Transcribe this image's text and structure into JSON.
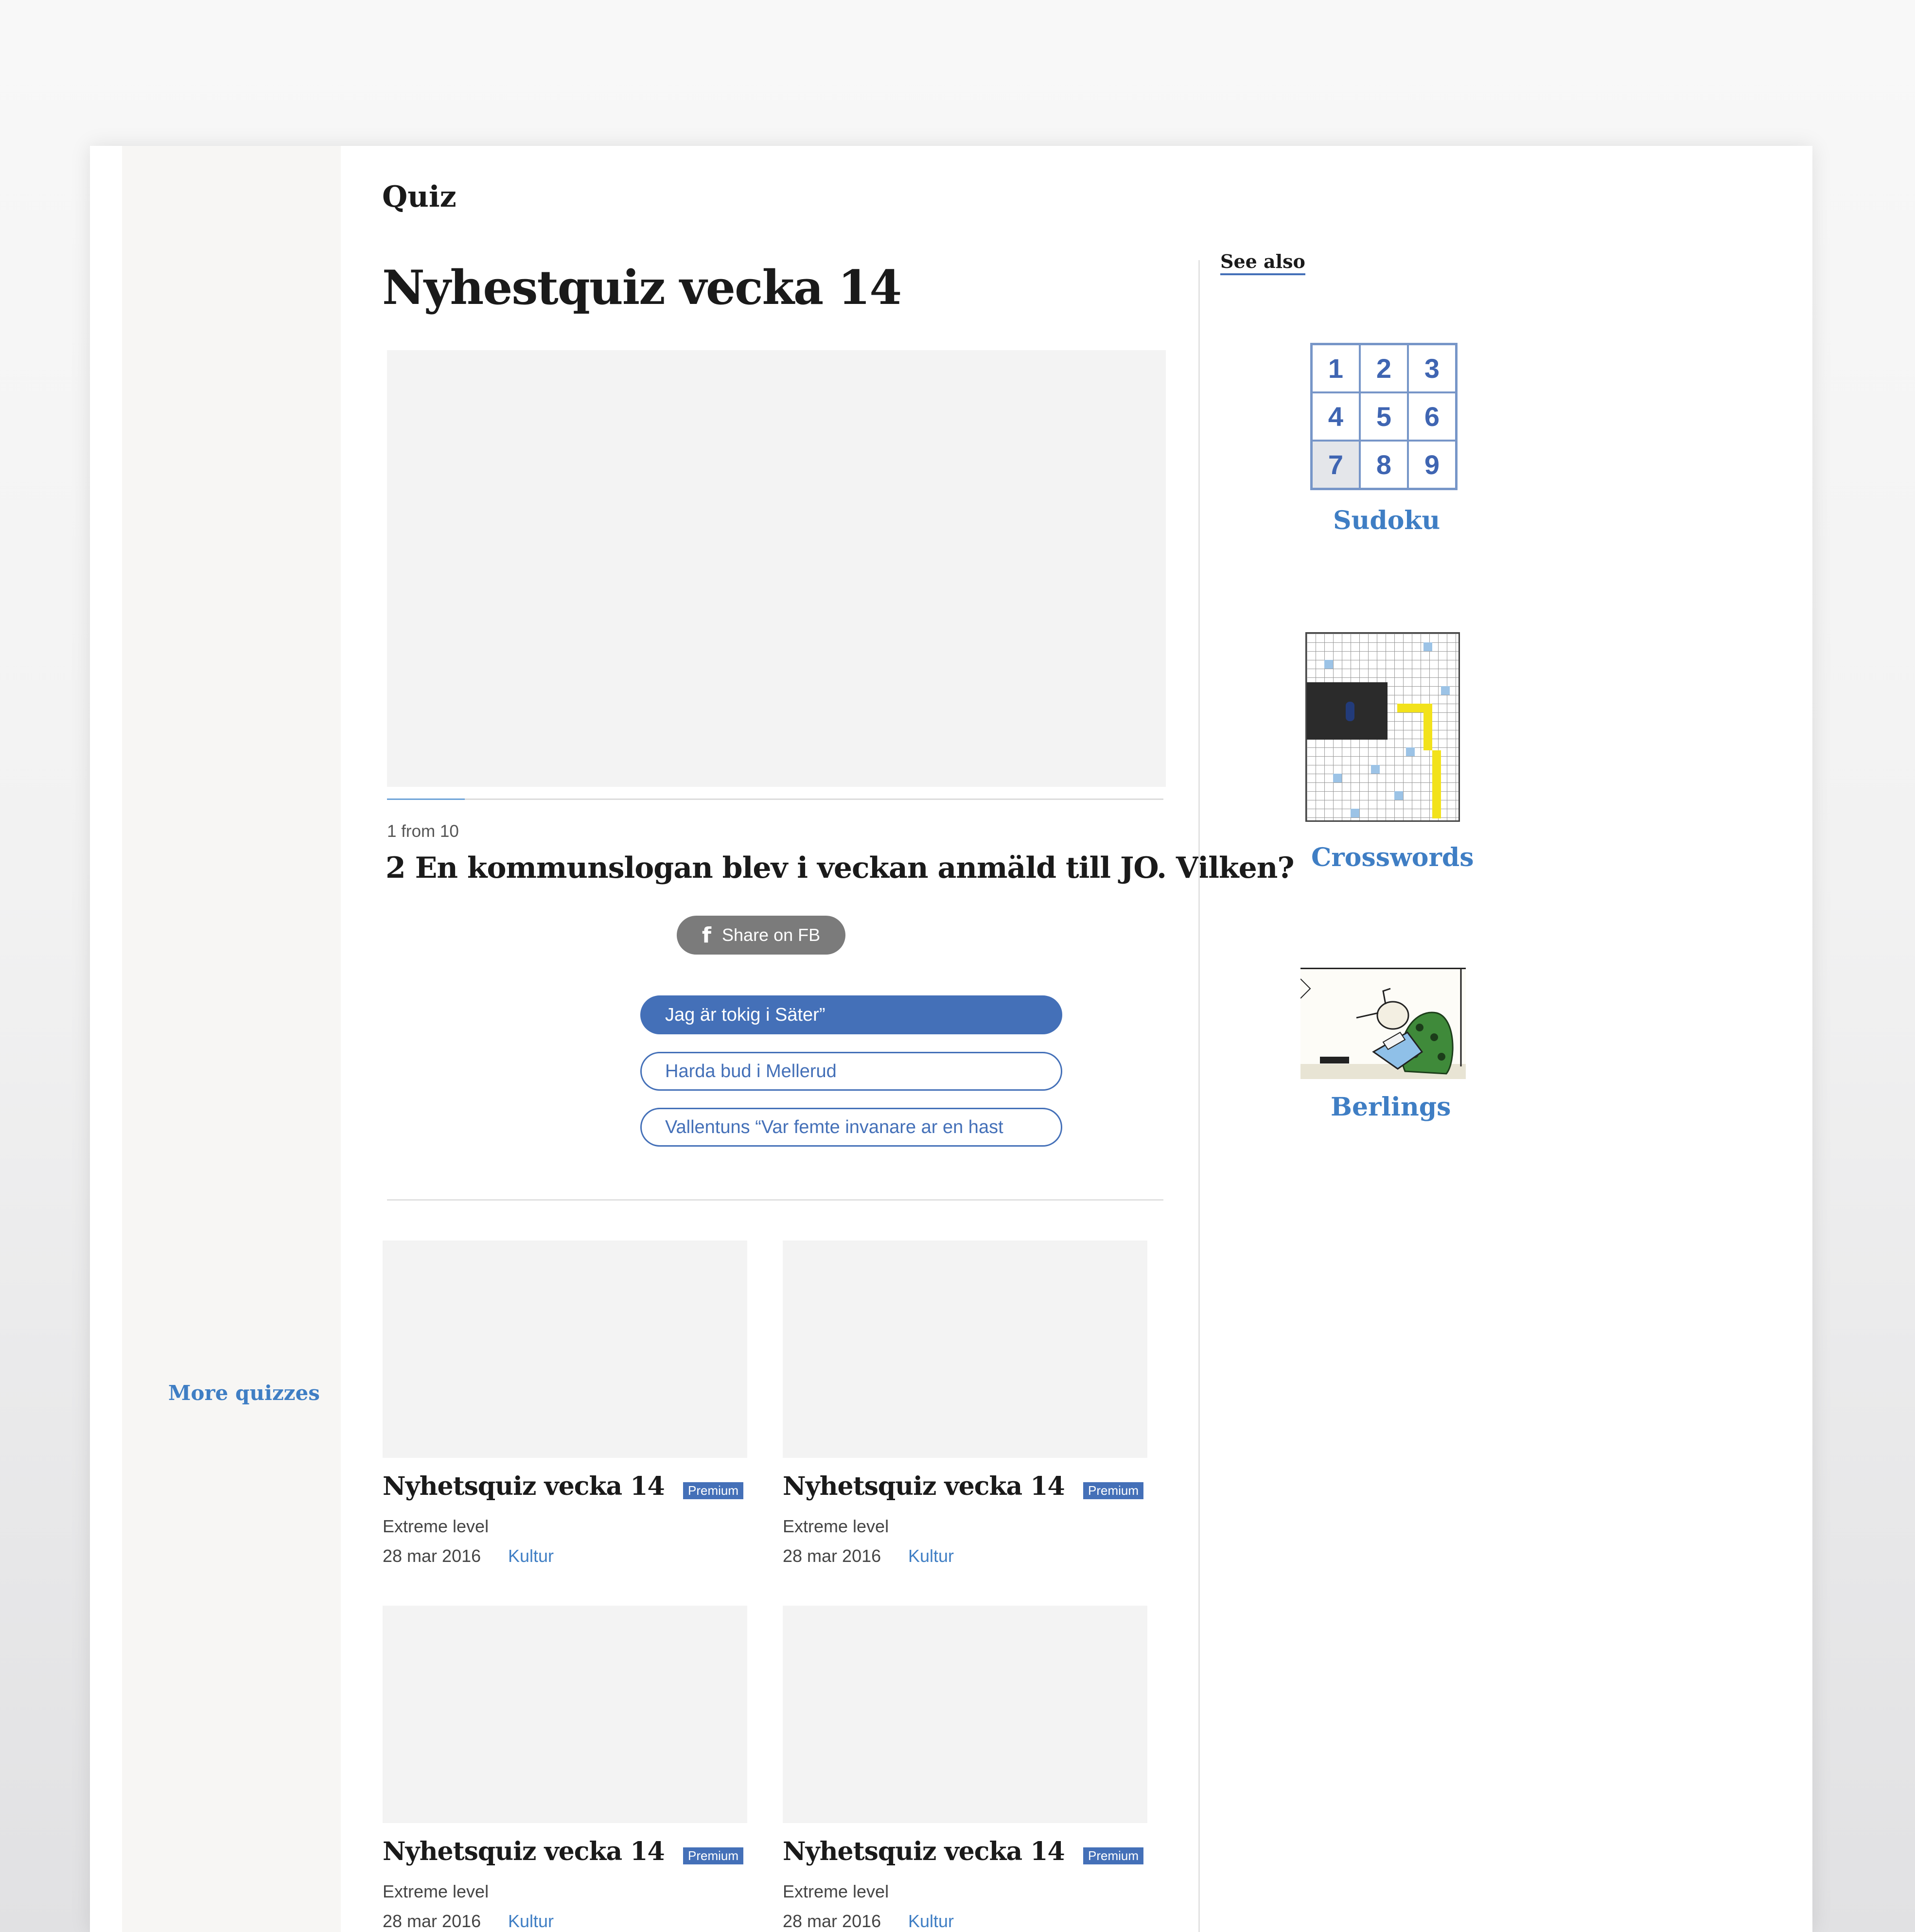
{
  "section": {
    "title": "Quiz"
  },
  "quiz": {
    "title": "Nyhestquiz vecka 14",
    "progress_text": "1 from 10",
    "progress_fraction": 0.1,
    "question": "2 En kommunslogan blev i veckan anmäld till JO. Vilken?",
    "share_label": "Share on FB",
    "answers": [
      {
        "label": "Jag är tokig i Säter”",
        "selected": true
      },
      {
        "label": "Harda bud i Mellerud",
        "selected": false
      },
      {
        "label": "Vallentuns “Var femte invanare ar en hast",
        "selected": false
      }
    ]
  },
  "sidebar": {
    "more_label": "More quizzes"
  },
  "cards": [
    {
      "title": "Nyhetsquiz vecka 14",
      "badge": "Premium",
      "level": "Extreme level",
      "date": "28 mar 2016",
      "category": "Kultur"
    },
    {
      "title": "Nyhetsquiz vecka 14",
      "badge": "Premium",
      "level": "Extreme level",
      "date": "28 mar 2016",
      "category": "Kultur"
    },
    {
      "title": "Nyhetsquiz vecka 14",
      "badge": "Premium",
      "level": "Extreme level",
      "date": "28 mar 2016",
      "category": "Kultur"
    },
    {
      "title": "Nyhetsquiz vecka 14",
      "badge": "Premium",
      "level": "Extreme level",
      "date": "28 mar 2016",
      "category": "Kultur"
    }
  ],
  "see_also": {
    "title": "See also",
    "sudoku": {
      "label": "Sudoku",
      "digits": [
        "1",
        "2",
        "3",
        "4",
        "5",
        "6",
        "7",
        "8",
        "9"
      ]
    },
    "crosswords": {
      "label": "Crosswords"
    },
    "berlings": {
      "label": "Berlings"
    }
  },
  "colors": {
    "accent": "#4470b8",
    "link": "#3f7ec4",
    "rail": "#f7f6f4",
    "placeholder": "#f3f3f3"
  },
  "icons": {
    "share": "facebook-icon"
  }
}
